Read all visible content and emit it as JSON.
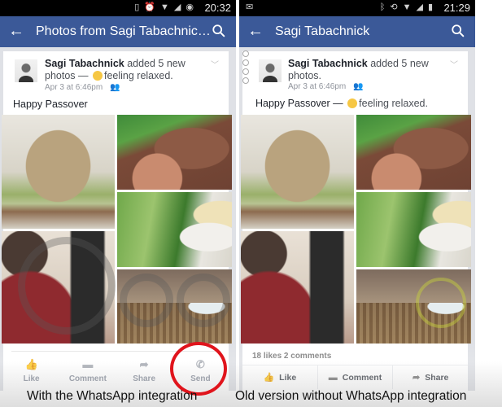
{
  "left_phone": {
    "status_bar": {
      "icons": [
        "vibrate-icon",
        "alarm-icon",
        "wifi-icon",
        "signal-icon",
        "battery-icon"
      ],
      "time": "20:32"
    },
    "app_bar": {
      "back_icon": "arrow-left-icon",
      "title": "Photos from Sagi Tabachnic…",
      "search_icon": "search-icon"
    },
    "post": {
      "author": "Sagi Tabachnick",
      "action_text": " added 5 new photos — ",
      "feeling": "feeling relaxed.",
      "timestamp": "Apr 3 at 6:46pm",
      "audience_icon": "friends-icon",
      "caption": "Happy Passover",
      "photo_count": 5,
      "actions": [
        {
          "icon": "thumbs-up-icon",
          "label": "Like"
        },
        {
          "icon": "comment-icon",
          "label": "Comment"
        },
        {
          "icon": "share-icon",
          "label": "Share"
        },
        {
          "icon": "whatsapp-icon",
          "label": "Send"
        }
      ]
    },
    "annotation_color": "#e0141c"
  },
  "right_phone": {
    "status_bar": {
      "left_icons": [
        "gmail-icon"
      ],
      "icons": [
        "bluetooth-icon",
        "rotate-icon",
        "wifi-icon",
        "signal-icon",
        "battery-icon"
      ],
      "time": "21:29"
    },
    "app_bar": {
      "back_icon": "arrow-left-icon",
      "title": "Sagi Tabachnick",
      "search_icon": "search-icon"
    },
    "post": {
      "author": "Sagi Tabachnick",
      "action_text": " added 5 new photos.",
      "timestamp": "Apr 3 at 6:46pm",
      "audience_icon": "friends-icon",
      "caption": "Happy Passover — ",
      "feeling": "feeling relaxed.",
      "photo_count": 5,
      "counts": "18 likes  2 comments",
      "actions": [
        {
          "icon": "thumbs-up-icon",
          "label": "Like"
        },
        {
          "icon": "comment-icon",
          "label": "Comment"
        },
        {
          "icon": "share-icon",
          "label": "Share"
        }
      ]
    }
  },
  "captions": {
    "left": "With the WhatsApp integration",
    "right": "Old version without WhatsApp integration"
  },
  "colors": {
    "facebook_blue": "#3b5998",
    "highlight_red": "#e0141c"
  }
}
